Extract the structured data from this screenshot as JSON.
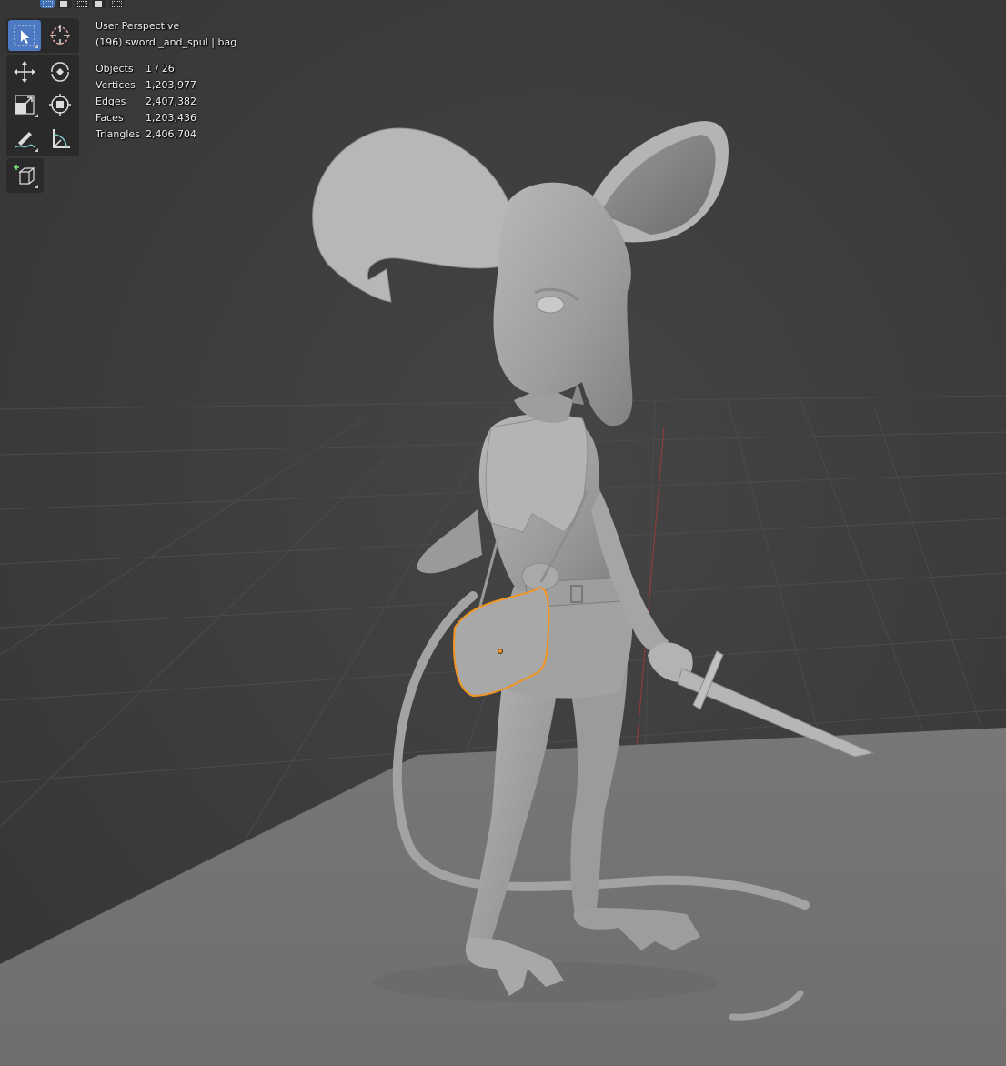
{
  "viewport": {
    "view_name": "User Perspective",
    "active_object": "(196) sword _and_spul | bag"
  },
  "stats": [
    {
      "label": "Objects",
      "value": "1 / 26"
    },
    {
      "label": "Vertices",
      "value": "1,203,977"
    },
    {
      "label": "Edges",
      "value": "2,407,382"
    },
    {
      "label": "Faces",
      "value": "1,203,436"
    },
    {
      "label": "Triangles",
      "value": "2,406,704"
    }
  ],
  "toolbar": {
    "tools": [
      {
        "name": "select-box",
        "icon": "select-box-icon",
        "active": true
      },
      {
        "name": "cursor",
        "icon": "cursor-icon",
        "active": false
      },
      {
        "name": "move",
        "icon": "move-icon",
        "active": false
      },
      {
        "name": "rotate",
        "icon": "rotate-icon",
        "active": false
      },
      {
        "name": "scale",
        "icon": "scale-icon",
        "active": false
      },
      {
        "name": "transform",
        "icon": "transform-icon",
        "active": false
      },
      {
        "name": "annotate",
        "icon": "annotate-icon",
        "active": false
      },
      {
        "name": "measure",
        "icon": "measure-icon",
        "active": false
      },
      {
        "name": "add-cube",
        "icon": "add-cube-icon",
        "active": false
      }
    ]
  },
  "colors": {
    "background": "#3d3d3d",
    "grid": "#4a4a4a",
    "floor": "#7a7a7a",
    "model": "#a6a6a6",
    "selection": "#f29421",
    "active_tool": "#4c79c1"
  }
}
